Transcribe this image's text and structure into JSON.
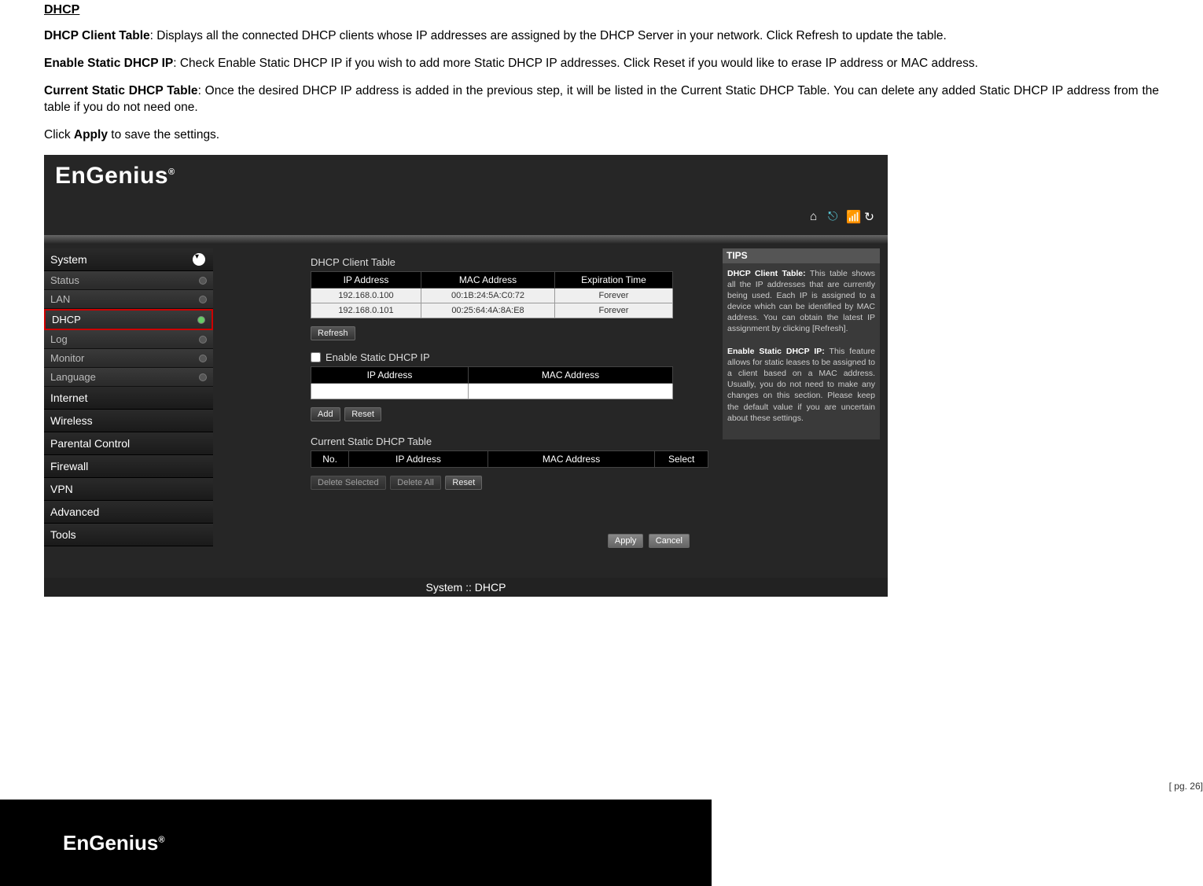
{
  "doc": {
    "heading": "DHCP",
    "p1_bold": "DHCP Client Table",
    "p1_text": ": Displays all the connected DHCP clients whose IP addresses are assigned by the DHCP Server in your network. Click Refresh to update the table.",
    "p2_bold": "Enable Static DHCP IP",
    "p2_text": ": Check Enable Static DHCP IP if you wish to add more Static DHCP IP addresses. Click Reset if you would like to erase IP address or MAC address.",
    "p3_bold": "Current Static DHCP Table",
    "p3_text": ": Once the desired DHCP IP address is added in the previous step, it will be listed in the Current Static DHCP Table. You can delete any added Static DHCP IP address from the table if you do not need one.",
    "p4_pre": "Click ",
    "p4_bold": "Apply",
    "p4_post": " to save the settings."
  },
  "ui": {
    "brand": "EnGenius",
    "reg": "®",
    "sidebar": {
      "sys": "System",
      "subs": [
        "Status",
        "LAN",
        "DHCP",
        "Log",
        "Monitor",
        "Language"
      ],
      "active_index": 2,
      "cats": [
        "Internet",
        "Wireless",
        "Parental Control",
        "Firewall",
        "VPN",
        "Advanced",
        "Tools"
      ]
    },
    "client_table": {
      "title": "DHCP Client Table",
      "cols": [
        "IP Address",
        "MAC Address",
        "Expiration Time"
      ],
      "rows": [
        {
          "ip": "192.168.0.100",
          "mac": "00:1B:24:5A:C0:72",
          "exp": "Forever"
        },
        {
          "ip": "192.168.0.101",
          "mac": "00:25:64:4A:8A:E8",
          "exp": "Forever"
        }
      ]
    },
    "refresh": "Refresh",
    "enable_static": "Enable Static DHCP IP",
    "static_cols": [
      "IP Address",
      "MAC Address"
    ],
    "add": "Add",
    "reset": "Reset",
    "cur_static": {
      "title": "Current Static DHCP Table",
      "cols": [
        "No.",
        "IP Address",
        "MAC Address",
        "Select"
      ]
    },
    "del_sel": "Delete Selected",
    "del_all": "Delete All",
    "apply": "Apply",
    "cancel": "Cancel",
    "breadcrumb": "System :: DHCP",
    "tips": {
      "title": "TIPS",
      "t1b": "DHCP Client Table:",
      "t1": " This table shows all the IP addresses that are currently being used. Each IP is assigned to a device which can be identified by MAC address. You can obtain the latest IP assignment by clicking [Refresh].",
      "t2b": "Enable Static DHCP IP:",
      "t2": " This feature allows for static leases to be assigned to a client based on a MAC address. Usually, you do not need to make any changes on this section. Please keep the default value if you are uncertain about these settings."
    }
  },
  "page_num": "[ pg. 26]"
}
